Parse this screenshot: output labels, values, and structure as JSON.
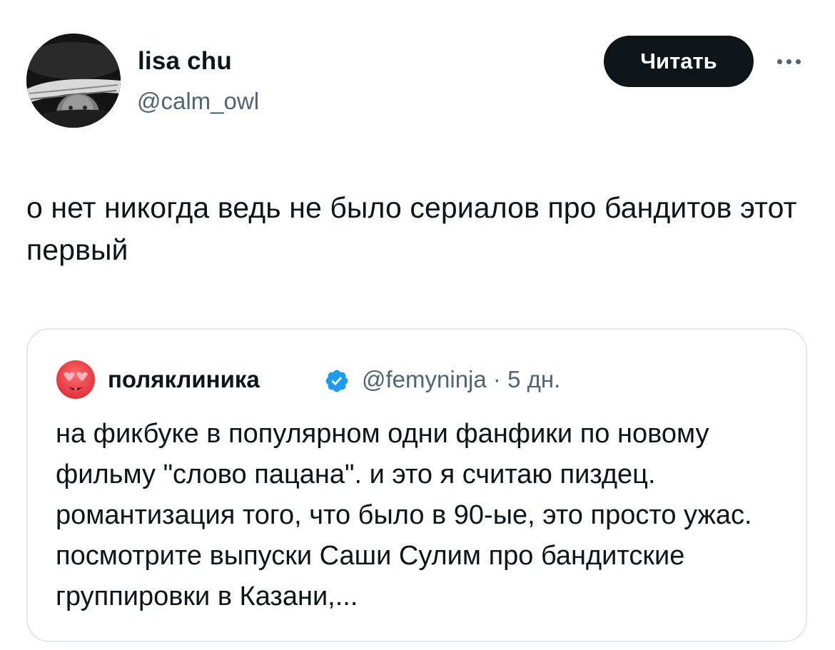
{
  "author": {
    "display_name": "lisa chu",
    "handle": "@calm_owl",
    "avatar_icon": "user-photo-avatar"
  },
  "actions": {
    "follow_label": "Читать",
    "more_icon": "more-horizontal-icon"
  },
  "tweet": {
    "text": "о нет никогда ведь не было сериалов про бандитов этот первый"
  },
  "quote": {
    "display_name": "поляклиника",
    "verified_icon": "verified-badge-icon",
    "handle": "@femyninja",
    "separator": "·",
    "time": "5 дн.",
    "avatar_icon": "hot-face-emoji-icon",
    "text": "на фикбуке в популярном одни фанфики по новому фильму \"слово пацана\". и это я считаю пиздец. романтизация того, что было в 90-ые, это просто ужас. посмотрите выпуски Саши Сулим про бандитские группировки в Казани,..."
  },
  "colors": {
    "text_primary": "#0f1419",
    "text_secondary": "#536471",
    "button_bg": "#0f1419",
    "verified_blue": "#1d9bf0",
    "border": "#e3e7ea"
  }
}
